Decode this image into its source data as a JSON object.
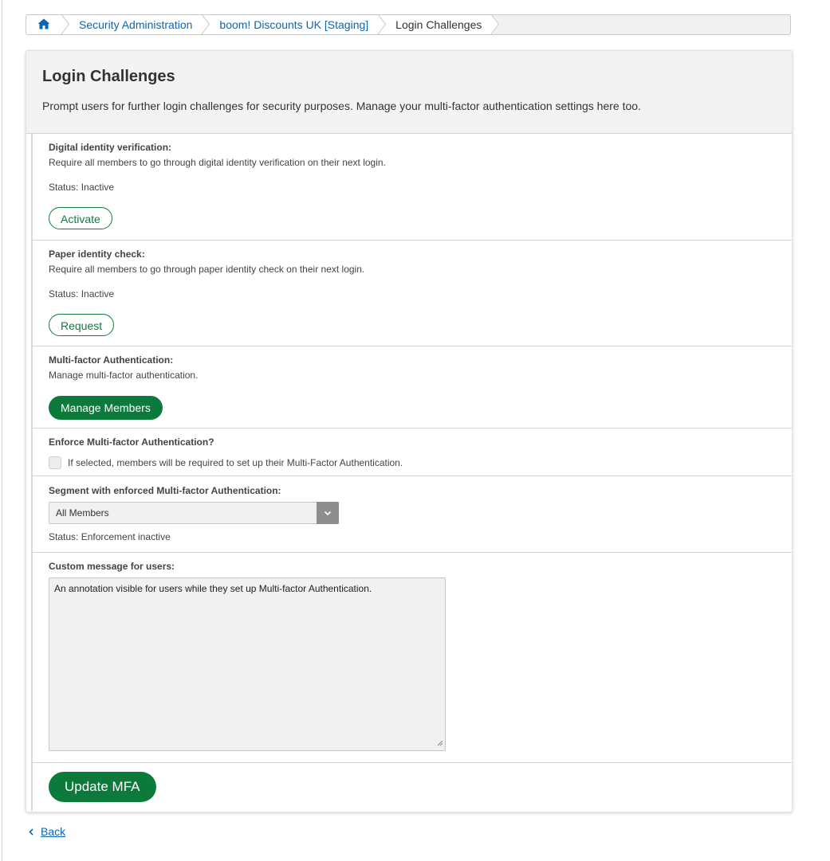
{
  "breadcrumb": {
    "home_icon": "home-icon",
    "items": [
      {
        "label": "Security Administration"
      },
      {
        "label": "boom! Discounts UK [Staging]"
      },
      {
        "label": "Login Challenges"
      }
    ]
  },
  "page": {
    "title": "Login Challenges",
    "subtitle": "Prompt users for further login challenges for security purposes. Manage your multi-factor authentication settings here too."
  },
  "sections": {
    "digital": {
      "label": "Digital identity verification:",
      "description": "Require all members to go through digital identity verification on their next login.",
      "status": "Status: Inactive",
      "button": "Activate"
    },
    "paper": {
      "label": "Paper identity check:",
      "description": "Require all members to go through paper identity check on their next login.",
      "status": "Status: Inactive",
      "button": "Request"
    },
    "mfa": {
      "label": "Multi-factor Authentication:",
      "description": "Manage multi-factor authentication.",
      "button": "Manage Members"
    },
    "enforce": {
      "label": "Enforce Multi-factor Authentication?",
      "checkbox_label": "If selected, members will be required to set up their Multi-Factor Authentication.",
      "checked": false
    },
    "segment": {
      "label": "Segment with enforced Multi-factor Authentication:",
      "selected": "All Members",
      "status": "Status: Enforcement inactive"
    },
    "message": {
      "label": "Custom message for users:",
      "value": "An annotation visible for users while they set up Multi-factor Authentication."
    }
  },
  "actions": {
    "update": "Update MFA",
    "back": "Back"
  },
  "colors": {
    "accent_green": "#0b7a3b",
    "link_blue": "#0a66b2"
  }
}
